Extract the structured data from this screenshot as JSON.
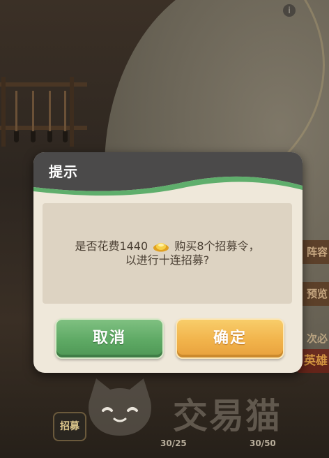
{
  "background": {
    "info_glyph": "i",
    "side_banners": [
      "阵容",
      "预览",
      "次必",
      "英雄"
    ],
    "recruit_badge": "招募",
    "counters": [
      "30/25",
      "30/50"
    ]
  },
  "watermark": {
    "text": "交易猫",
    "icon": "cat-logo"
  },
  "dialog": {
    "title": "提示",
    "message_before_icon": "是否花费1440",
    "currency_icon": "gold-ingot-icon",
    "message_after_icon": "购买8个招募令，",
    "message_line2": "以进行十连招募?",
    "cancel_label": "取消",
    "confirm_label": "确定"
  },
  "colors": {
    "header": "#4b4a4a",
    "header_wave": "#5fae6c",
    "panel": "#efe8da",
    "body": "#ddd3c2",
    "cancel": "#5ea964",
    "confirm": "#f1b34b"
  }
}
